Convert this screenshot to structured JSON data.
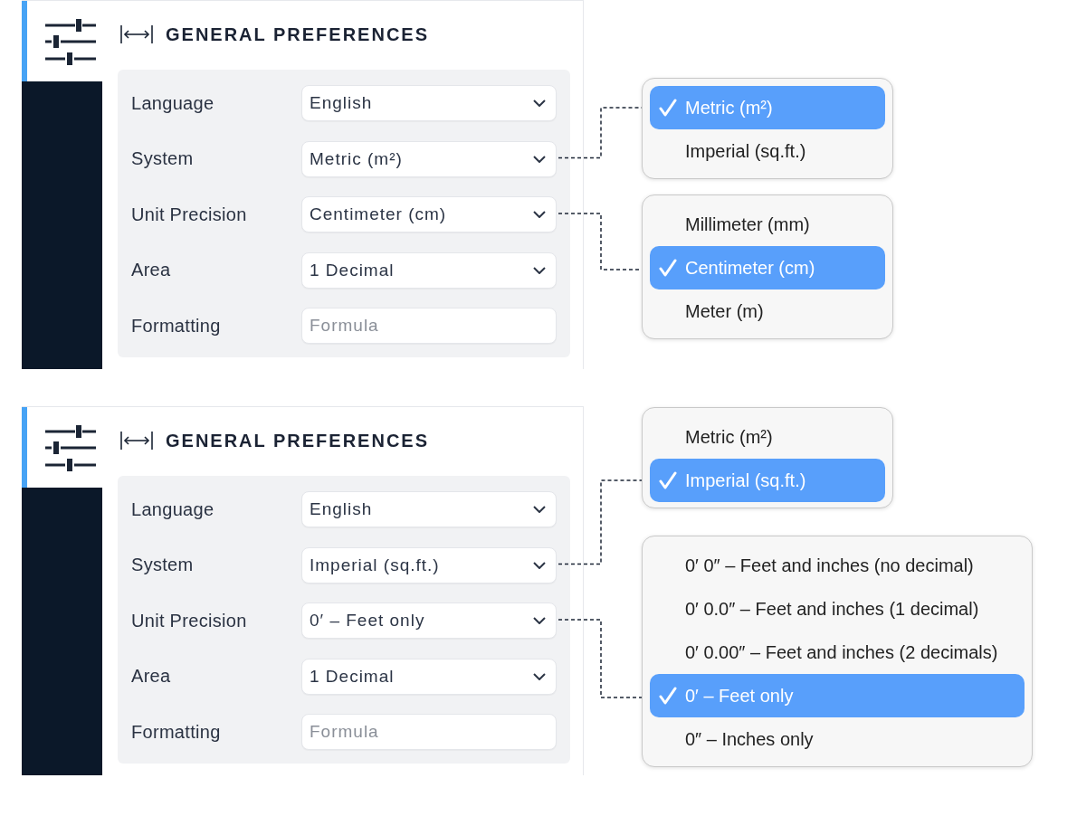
{
  "sections": [
    {
      "sidebar_items": [
        {
          "selected": true
        }
      ],
      "title": "GENERAL PREFERENCES",
      "fields": [
        {
          "kind": "select",
          "label": "Language",
          "value": "English"
        },
        {
          "kind": "select",
          "label": "System",
          "value": "Metric (m²)",
          "options": [
            {
              "label": "Metric (m²)",
              "selected": true
            },
            {
              "label": "Imperial (sq.ft.)",
              "selected": false
            }
          ]
        },
        {
          "kind": "select",
          "label": "Unit Precision",
          "value": "Centimeter (cm)",
          "options": [
            {
              "label": "Millimeter (mm)",
              "selected": false
            },
            {
              "label": "Centimeter (cm)",
              "selected": true
            },
            {
              "label": "Meter (m)",
              "selected": false
            }
          ]
        },
        {
          "kind": "select",
          "label": "Area",
          "value": "1 Decimal"
        },
        {
          "kind": "text",
          "label": "Formatting",
          "placeholder": "Formula"
        }
      ]
    },
    {
      "sidebar_items": [
        {
          "selected": true
        }
      ],
      "title": "GENERAL PREFERENCES",
      "fields": [
        {
          "kind": "select",
          "label": "Language",
          "value": "English"
        },
        {
          "kind": "select",
          "label": "System",
          "value": "Imperial (sq.ft.)",
          "options": [
            {
              "label": "Metric (m²)",
              "selected": false
            },
            {
              "label": "Imperial (sq.ft.)",
              "selected": true
            }
          ]
        },
        {
          "kind": "select",
          "label": "Unit Precision",
          "value": "0′ – Feet only",
          "options": [
            {
              "label": "0′ 0″ – Feet and inches (no decimal)",
              "selected": false
            },
            {
              "label": "0′ 0.0″ – Feet and inches (1 decimal)",
              "selected": false
            },
            {
              "label": "0′ 0.00″ – Feet and inches (2 decimals)",
              "selected": false
            },
            {
              "label": "0′ – Feet only",
              "selected": true
            },
            {
              "label": "0″ – Inches only",
              "selected": false
            }
          ]
        },
        {
          "kind": "select",
          "label": "Area",
          "value": "1 Decimal"
        },
        {
          "kind": "text",
          "label": "Formatting",
          "placeholder": "Formula"
        }
      ]
    }
  ]
}
